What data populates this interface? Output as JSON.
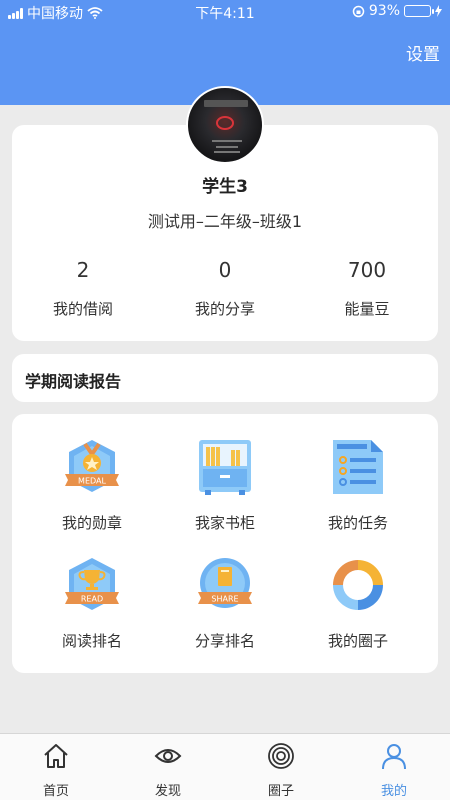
{
  "status_bar": {
    "carrier": "中国移动",
    "time": "下午4:11",
    "battery": "93%",
    "battery_level": 0.93
  },
  "header": {
    "settings_label": "设置"
  },
  "profile": {
    "name": "学生3",
    "class_info": "测试用–二年级–班级1",
    "stats": [
      {
        "value": "2",
        "label": "我的借阅"
      },
      {
        "value": "0",
        "label": "我的分享"
      },
      {
        "value": "700",
        "label": "能量豆"
      }
    ]
  },
  "report": {
    "label": "学期阅读报告"
  },
  "features": [
    {
      "label": "我的勋章",
      "icon": "medal-icon",
      "badge_text": "MEDAL"
    },
    {
      "label": "我家书柜",
      "icon": "bookshelf-icon"
    },
    {
      "label": "我的任务",
      "icon": "task-list-icon"
    },
    {
      "label": "阅读排名",
      "icon": "read-trophy-icon",
      "badge_text": "READ"
    },
    {
      "label": "分享排名",
      "icon": "share-book-icon",
      "badge_text": "SHARE"
    },
    {
      "label": "我的圈子",
      "icon": "circle-swirl-icon"
    }
  ],
  "tabs": [
    {
      "label": "首页",
      "icon": "home-icon"
    },
    {
      "label": "发现",
      "icon": "eye-icon"
    },
    {
      "label": "圈子",
      "icon": "rings-icon"
    },
    {
      "label": "我的",
      "icon": "person-icon",
      "active": true
    }
  ],
  "colors": {
    "primary": "#5b95f3",
    "active_tab": "#4a90e2",
    "background": "#ebebeb"
  }
}
